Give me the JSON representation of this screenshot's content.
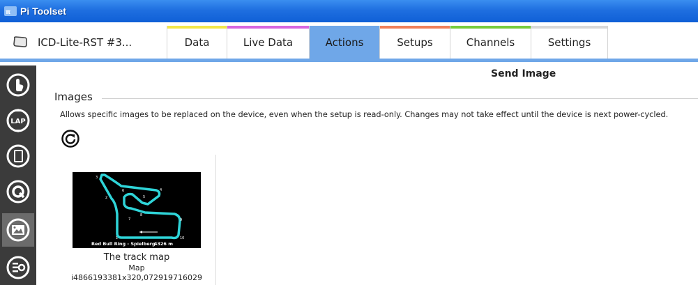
{
  "window": {
    "title": "Pi Toolset",
    "icon": "pi-logo-icon"
  },
  "tabs": [
    {
      "label": "ICD-Lite-RST #3...",
      "icon": "device-icon",
      "strip_color": "#ffffff",
      "active": false
    },
    {
      "label": "Data",
      "strip_color": "#f2e64a",
      "active": false
    },
    {
      "label": "Live Data",
      "strip_color": "#d667e0",
      "active": false
    },
    {
      "label": "Actions",
      "strip_color": "#6fa7e8",
      "active": true
    },
    {
      "label": "Setups",
      "strip_color": "#f0805a",
      "active": false
    },
    {
      "label": "Channels",
      "strip_color": "#77cc3c",
      "active": false
    },
    {
      "label": "Settings",
      "strip_color": "#d8d8d8",
      "active": false
    }
  ],
  "sidebar": {
    "items": [
      {
        "name": "touch-icon",
        "active": false
      },
      {
        "name": "lap-icon",
        "label": "LAP",
        "active": false
      },
      {
        "name": "device-screen-icon",
        "active": false
      },
      {
        "name": "q-icon",
        "active": false
      },
      {
        "name": "image-icon",
        "active": true
      },
      {
        "name": "list-icon",
        "active": false
      }
    ]
  },
  "main": {
    "page_title": "Send Image",
    "section_title": "Images",
    "description": "Allows specific images to be replaced on the device, even when the setup is read-only.  Changes may not take effect until the device is next power-cycled.",
    "refresh_icon": "refresh-icon",
    "images": [
      {
        "name": "The track map",
        "type": "Map",
        "id": "i4866193381x320,072919716029,",
        "thumbnail": {
          "caption": "Red Bull Ring - Spielberg",
          "length": "4326 m",
          "corner_labels": [
            "1",
            "2",
            "3",
            "4",
            "5",
            "6",
            "7",
            "8",
            "9",
            "10"
          ],
          "track_color": "#2fd4d8"
        }
      }
    ]
  },
  "colors": {
    "accent": "#6fa7e8",
    "titlebar": "#1f6fe0",
    "sidebar": "#3b3b3b"
  }
}
